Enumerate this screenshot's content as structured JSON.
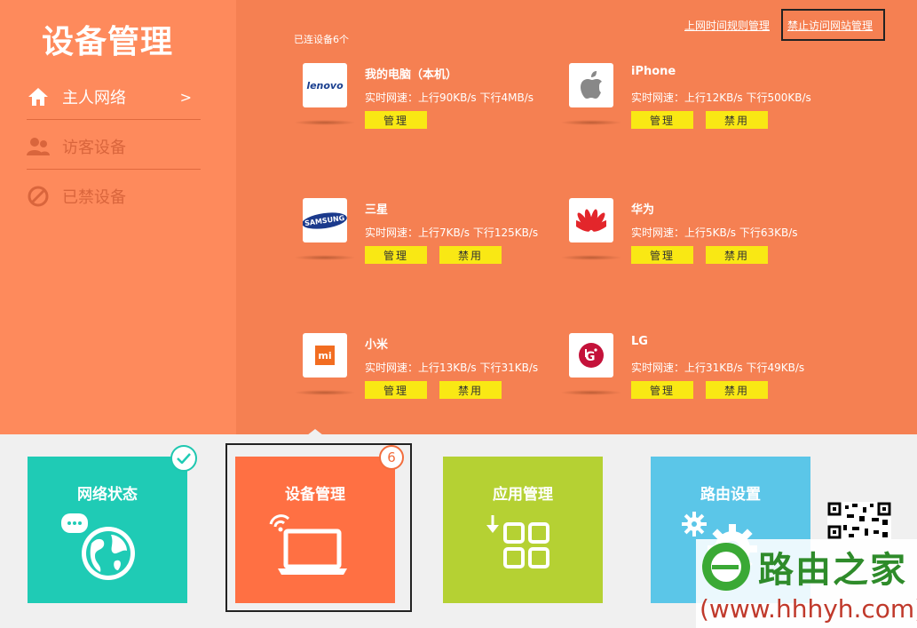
{
  "app": {
    "title": "设备管理"
  },
  "sidebar": {
    "items": [
      {
        "label": "主人网络",
        "icon": "home-icon",
        "chevron": ">",
        "active": true
      },
      {
        "label": "访客设备",
        "icon": "guest-users-icon",
        "active": false
      },
      {
        "label": "已禁设备",
        "icon": "blocked-icon",
        "active": false
      }
    ]
  },
  "main": {
    "connected_count": "已连设备6个",
    "links": {
      "schedule": "上网时间规则管理",
      "block_sites": "禁止访问网站管理"
    },
    "devices": [
      {
        "name": "我的电脑（本机）",
        "speed": "实时网速：上行90KB/s  下行4MB/s",
        "logo": "lenovo-logo",
        "manage": "管理"
      },
      {
        "name": "iPhone",
        "speed": "实时网速：上行12KB/s  下行500KB/s",
        "logo": "apple-logo",
        "manage": "管理",
        "block": "禁用"
      },
      {
        "name": "三星",
        "speed": "实时网速：上行7KB/s  下行125KB/s",
        "logo": "samsung-logo",
        "manage": "管理",
        "block": "禁用"
      },
      {
        "name": "华为",
        "speed": "实时网速：上行5KB/s  下行63KB/s",
        "logo": "huawei-logo",
        "manage": "管理",
        "block": "禁用"
      },
      {
        "name": "小米",
        "speed": "实时网速：上行13KB/s  下行31KB/s",
        "logo": "xiaomi-logo",
        "manage": "管理",
        "block": "禁用"
      },
      {
        "name": "LG",
        "speed": "实时网速：上行31KB/s  下行49KB/s",
        "logo": "lg-logo",
        "manage": "管理",
        "block": "禁用"
      }
    ],
    "logo_text": {
      "lenovo": "lenovo",
      "samsung": "SAMSUNG",
      "xiaomi": "mi"
    }
  },
  "tiles": [
    {
      "label": "网络状态",
      "color": "#1fcbb5",
      "icon": "globe-chat-icon"
    },
    {
      "label": "设备管理",
      "color": "#ff7043",
      "icon": "laptop-wifi-icon",
      "badge": "6"
    },
    {
      "label": "应用管理",
      "color": "#b5d133",
      "icon": "apps-grid-icon"
    },
    {
      "label": "路由设置",
      "color": "#5bc6e8",
      "icon": "gears-icon"
    }
  ],
  "watermark": {
    "brand": "路由之家",
    "url": "(www.hhhyh.com)"
  },
  "colors": {
    "panel": "#f58052",
    "sidebar": "#fe8a5c",
    "button": "#f9e814"
  }
}
